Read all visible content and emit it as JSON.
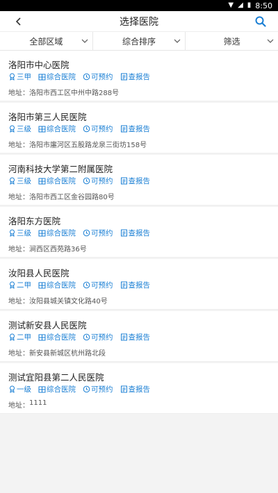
{
  "status": {
    "time": "8:50"
  },
  "header": {
    "title": "选择医院"
  },
  "filters": [
    {
      "label": "全部区域"
    },
    {
      "label": "综合排序"
    },
    {
      "label": "筛选"
    }
  ],
  "address_prefix": "地址：",
  "hospitals": [
    {
      "name": "洛阳市中心医院",
      "level": "三甲",
      "type": "综合医院",
      "booking": "可预约",
      "report": "查报告",
      "address": "洛阳市西工区中州中路288号"
    },
    {
      "name": "洛阳市第三人民医院",
      "level": "三级",
      "type": "综合医院",
      "booking": "可预约",
      "report": "查报告",
      "address": "洛阳市廛河区五股路龙泉三街坊158号"
    },
    {
      "name": "河南科技大学第二附属医院",
      "level": "三级",
      "type": "综合医院",
      "booking": "可预约",
      "report": "查报告",
      "address": "洛阳市西工区金谷园路80号"
    },
    {
      "name": "洛阳东方医院",
      "level": "三级",
      "type": "综合医院",
      "booking": "可预约",
      "report": "查报告",
      "address": "涧西区西苑路36号"
    },
    {
      "name": "汝阳县人民医院",
      "level": "二甲",
      "type": "综合医院",
      "booking": "可预约",
      "report": "查报告",
      "address": "汝阳县城关镇文化路40号"
    },
    {
      "name": "测试新安县人民医院",
      "level": "二甲",
      "type": "综合医院",
      "booking": "可预约",
      "report": "查报告",
      "address": "新安县新城区杭州路北段"
    },
    {
      "name": "测试宜阳县第二人民医院",
      "level": "一级",
      "type": "综合医院",
      "booking": "可预约",
      "report": "查报告",
      "address": "1111"
    }
  ],
  "colors": {
    "accent": "#1a7fd4"
  }
}
